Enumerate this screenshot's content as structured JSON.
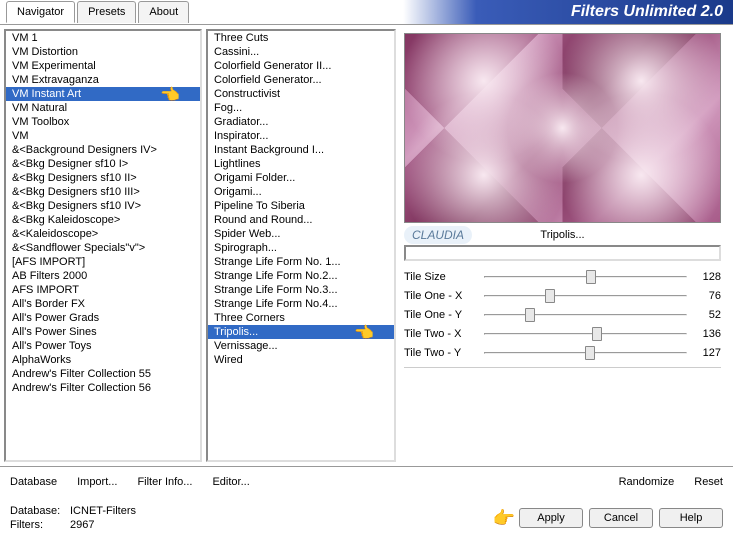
{
  "header": {
    "tabs": [
      "Navigator",
      "Presets",
      "About"
    ],
    "title": "Filters Unlimited 2.0"
  },
  "navigator_list": [
    "VM 1",
    "VM Distortion",
    "VM Experimental",
    "VM Extravaganza",
    "VM Instant Art",
    "VM Natural",
    "VM Toolbox",
    "VM",
    "&<Background Designers IV>",
    "&<Bkg Designer sf10 I>",
    "&<Bkg Designers sf10 II>",
    "&<Bkg Designers sf10 III>",
    "&<Bkg Designers sf10 IV>",
    "&<Bkg Kaleidoscope>",
    "&<Kaleidoscope>",
    "&<Sandflower Specials\"v\">",
    "[AFS IMPORT]",
    "AB Filters 2000",
    "AFS IMPORT",
    "All's Border FX",
    "All's Power Grads",
    "All's Power Sines",
    "All's Power Toys",
    "AlphaWorks",
    "Andrew's Filter Collection 55",
    "Andrew's Filter Collection 56"
  ],
  "navigator_selected": 4,
  "filter_list": [
    "Three Cuts",
    "Cassini...",
    "Colorfield Generator II...",
    "Colorfield Generator...",
    "Constructivist",
    "Fog...",
    "Gradiator...",
    "Inspirator...",
    "Instant Background I...",
    "Lightlines",
    "Origami Folder...",
    "Origami...",
    "Pipeline To Siberia",
    "Round and Round...",
    "Spider Web...",
    "Spirograph...",
    "Strange Life Form No. 1...",
    "Strange Life Form No.2...",
    "Strange Life Form No.3...",
    "Strange Life Form No.4...",
    "Three Corners",
    "Tripolis...",
    "Vernissage...",
    "Wired"
  ],
  "filter_selected": 21,
  "preview": {
    "filter_name": "Tripolis...",
    "watermark": "CLAUDIA"
  },
  "sliders": [
    {
      "label": "Tile Size",
      "value": 128,
      "max": 255
    },
    {
      "label": "Tile One - X",
      "value": 76,
      "max": 255
    },
    {
      "label": "Tile One - Y",
      "value": 52,
      "max": 255
    },
    {
      "label": "Tile Two - X",
      "value": 136,
      "max": 255
    },
    {
      "label": "Tile Two - Y",
      "value": 127,
      "max": 255
    }
  ],
  "bottom_bar": {
    "database": "Database",
    "import": "Import...",
    "filter_info": "Filter Info...",
    "editor": "Editor...",
    "randomize": "Randomize",
    "reset": "Reset"
  },
  "footer": {
    "db_label": "Database:",
    "db_value": "ICNET-Filters",
    "filters_label": "Filters:",
    "filters_value": "2967",
    "apply": "Apply",
    "cancel": "Cancel",
    "help": "Help"
  }
}
